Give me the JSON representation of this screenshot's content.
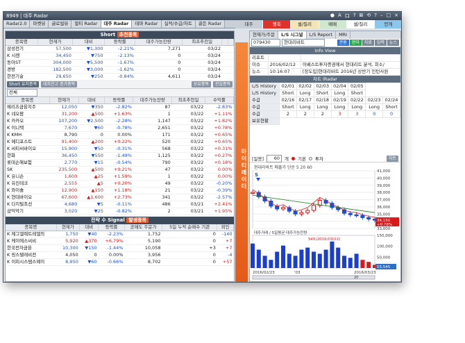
{
  "window": {
    "title": "8949 | 대주 Radar",
    "controls": [
      "●",
      "A",
      "口",
      "?",
      "⊠",
      "⟲",
      "?",
      "–",
      "□",
      "×"
    ]
  },
  "tabs": [
    "Radar2.0",
    "마켓뷰",
    "글로벌뷰",
    "멀티 Radar",
    "대주 Radar",
    "테마 Radar",
    "실적/수급/차트",
    "골든 Radar"
  ],
  "right_tabs": [
    {
      "label": "대주",
      "bg": "#c9cfd6"
    },
    {
      "label": "행복",
      "bg": "#e0312a",
      "color": "#fff"
    },
    {
      "label": "셀/질리",
      "bg": "#f4e4b8"
    },
    {
      "label": "매매",
      "bg": "#cfe8cf"
    },
    {
      "label": "셀/질리",
      "bg": "#ffffff"
    },
    {
      "label": "안개",
      "bg": "#8bc6ec"
    }
  ],
  "short_panel": {
    "title_prefix": "Short",
    "title_highlight": "추천종목",
    "headers": [
      "종목명",
      "현재가",
      "대비",
      "등락률",
      "대주가능잔량",
      "최초추천일",
      "",
      ""
    ],
    "rows": [
      {
        "name": "삼성전기",
        "price": "57,500",
        "arrow": "▼",
        "diff": "1,300",
        "rate": "-2.21%",
        "qty": "7,271",
        "date": "03/22",
        "c7": "",
        "c8": ""
      },
      {
        "name": "K 시젠",
        "price": "34,450",
        "arrow": "▼",
        "diff": "750",
        "rate": "-2.13%",
        "qty": "0",
        "date": "03/24",
        "c7": "",
        "c8": ""
      },
      {
        "name": "동아ST",
        "price": "304,000",
        "arrow": "▼",
        "diff": "5,500",
        "rate": "-1.67%",
        "qty": "0",
        "date": "03/24",
        "c7": "",
        "c8": ""
      },
      {
        "name": "경방",
        "price": "182,500",
        "arrow": "▼",
        "diff": "3,000",
        "rate": "-1.62%",
        "qty": "0",
        "date": "03/24",
        "c7": "",
        "c8": ""
      },
      {
        "name": "한전기술",
        "price": "29,650",
        "arrow": "▼",
        "diff": "250",
        "rate": "-0.84%",
        "qty": "4,611",
        "date": "03/24",
        "c7": "",
        "c8": ""
      }
    ]
  },
  "short_list": {
    "btn1": "Short 유지종목",
    "btn2": "대차잔고 증가종목",
    "btn3": "보유종목",
    "btn4": "관심종목",
    "select": "전체",
    "headers": [
      "종목명",
      "현재가",
      "대비",
      "등락률",
      "대주가능잔량",
      "최초추천일",
      "수익률"
    ],
    "rows": [
      {
        "name": "메리츠금융지주",
        "price": "12,050",
        "arrow": "▼",
        "diff": "350",
        "rate": "-2.82%",
        "qty": "87",
        "date": "03/22",
        "ret": "-2.83%",
        "dir": "dn"
      },
      {
        "name": "K 네오팜",
        "price": "31,200",
        "arrow": "▲",
        "diff": "500",
        "rate": "+1.63%",
        "qty": "1",
        "date": "03/22",
        "ret": "+1.11%",
        "dir": "up"
      },
      {
        "name": "K 카카오",
        "price": "107,200",
        "arrow": "▼",
        "diff": "2,500",
        "rate": "-2.28%",
        "qty": "1,147",
        "date": "03/22",
        "ret": "+1.82%",
        "dir": "dn"
      },
      {
        "name": "K 이니텍",
        "price": "7,670",
        "arrow": "▼",
        "diff": "60",
        "rate": "-0.78%",
        "qty": "2,651",
        "date": "03/22",
        "ret": "+0.78%",
        "dir": "dn"
      },
      {
        "name": "K KMH",
        "price": "8,790",
        "arrow": "",
        "diff": "0",
        "rate": "0.00%",
        "qty": "171",
        "date": "03/22",
        "ret": "+0.65%",
        "dir": ""
      },
      {
        "name": "K 메디포스트",
        "price": "91,400",
        "arrow": "▲",
        "diff": "200",
        "rate": "+0.22%",
        "qty": "520",
        "date": "03/22",
        "ret": "+0.65%",
        "dir": "up"
      },
      {
        "name": "K 씨티씨바이오",
        "price": "15,900",
        "arrow": "▼",
        "diff": "50",
        "rate": "-0.31%",
        "qty": "568",
        "date": "03/22",
        "ret": "+0.31%",
        "dir": "dn"
      },
      {
        "name": "한화",
        "price": "36,450",
        "arrow": "▼",
        "diff": "550",
        "rate": "-1.49%",
        "qty": "1,125",
        "date": "03/22",
        "ret": "+0.27%",
        "dir": "dn"
      },
      {
        "name": "롯데손해보험",
        "price": "2,770",
        "arrow": "▼",
        "diff": "15",
        "rate": "-0.54%",
        "qty": "790",
        "date": "03/22",
        "ret": "+0.18%",
        "dir": "dn"
      },
      {
        "name": "SK",
        "price": "235,500",
        "arrow": "▲",
        "diff": "500",
        "rate": "+0.21%",
        "qty": "47",
        "date": "03/22",
        "ret": "0.00%",
        "dir": "up"
      },
      {
        "name": "K 유니슨",
        "price": "1,600",
        "arrow": "▲",
        "diff": "25",
        "rate": "+1.59%",
        "qty": "1",
        "date": "03/22",
        "ret": "0.00%",
        "dir": "up"
      },
      {
        "name": "K 유진테크",
        "price": "2,555",
        "arrow": "▲",
        "diff": "5",
        "rate": "+0.20%",
        "qty": "49",
        "date": "03/22",
        "ret": "-0.20%",
        "dir": "up"
      },
      {
        "name": "K 와이솔",
        "price": "12,900",
        "arrow": "▲",
        "diff": "150",
        "rate": "+1.18%",
        "qty": "21",
        "date": "03/22",
        "ret": "-0.39%",
        "dir": "up"
      },
      {
        "name": "K 현대바이오",
        "price": "67,600",
        "arrow": "▲",
        "diff": "1,600",
        "rate": "+2.73%",
        "qty": "341",
        "date": "03/22",
        "ret": "-2.57%",
        "dir": "up"
      },
      {
        "name": "K 다지털조선",
        "price": "4,680",
        "arrow": "▼",
        "diff": "5",
        "rate": "-0.11%",
        "qty": "486",
        "date": "03/21",
        "ret": "+2.41%",
        "dir": "dn"
      },
      {
        "name": "삼익악기",
        "price": "3,020",
        "arrow": "▼",
        "diff": "25",
        "rate": "-0.82%",
        "qty": "2",
        "date": "03/21",
        "ret": "+1.95%",
        "dir": "dn"
      }
    ]
  },
  "signal_panel": {
    "title_prefix": "전략 수 Signal",
    "title_highlight": "발생종목",
    "headers": [
      "종목명",
      "현재가",
      "대비",
      "등락률",
      "공매도 주문가",
      "5일 누적 순매수 기관",
      "외인"
    ],
    "rows": [
      {
        "name": "K 제그엘렉트레엘의",
        "price": "1,750",
        "arrow": "▼",
        "diff": "40",
        "rate": "-2.23%",
        "qty": "1,752",
        "inst": "0",
        "frgn": "-140",
        "dir": "dn"
      },
      {
        "name": "K 케이에스씨비",
        "price": "5,920",
        "arrow": "▲",
        "diff": "370",
        "rate": "+6.79%",
        "qty": "5,190",
        "inst": "0",
        "frgn": "+7",
        "dir": "up"
      },
      {
        "name": "한국전자금융",
        "price": "10,300",
        "arrow": "▼",
        "diff": "150",
        "rate": "-1.44%",
        "qty": "10,058",
        "inst": "+3",
        "frgn": "+7",
        "dir": "dn"
      },
      {
        "name": "K 링스텔레비전",
        "price": "4,050",
        "arrow": "",
        "diff": "0",
        "rate": "0.00%",
        "qty": "3,956",
        "inst": "0",
        "frgn": "-4",
        "dir": ""
      },
      {
        "name": "K 이피시스템스웨이",
        "price": "8,950",
        "arrow": "▼",
        "diff": "60",
        "rate": "-0.66%",
        "qty": "8,702",
        "inst": "0",
        "frgn": "+57",
        "dir": "dn"
      }
    ]
  },
  "banner": "마이티레이더",
  "right": {
    "subtabs": [
      "현재가/주문",
      "L/S 시그널",
      "L/S Report",
      "MRI"
    ],
    "code": "079430",
    "code_name": "현대리바트",
    "btns": [
      {
        "l": "관원",
        "bg": "#2f74d0"
      },
      {
        "l": "현자",
        "bg": "#2aa84a"
      },
      {
        "l": "자료",
        "bg": "#7a8797"
      },
      {
        "l": "입력",
        "bg": "#7a8797"
      },
      {
        "l": "뉴스",
        "bg": "#7a8797"
      }
    ],
    "info_title": "Info View",
    "info_rows": [
      {
        "k": "리포트",
        "d": "",
        "v": ""
      },
      {
        "k": "이슈",
        "d": "2016/02/12",
        "v": "이베스트투자증권에서 현대리트 분석, 희소/"
      },
      {
        "k": "뉴스",
        "d": "10:16:07",
        "v": "[장도입]현대리바트 2016년 상반기 인턴사원"
      }
    ],
    "chart_title": "차트 lRadar",
    "history_label": "L/S History",
    "supply_label": "수급",
    "trade_label": "보유현황",
    "history_dates": [
      "02/01",
      "02/02",
      "02/03",
      "02/04",
      "02/05"
    ],
    "history_vals": [
      "Short",
      "Long",
      "Short",
      "Long",
      "Short"
    ],
    "supply_dates": [
      "02/16",
      "02/17",
      "02/18",
      "02/19",
      "02/22",
      "02/23",
      "02/24"
    ],
    "supply_row1": [
      "Short",
      "Long",
      "Long",
      "Long",
      "Long",
      "Long",
      "Short"
    ],
    "supply_row2": [
      "2",
      "2",
      "2",
      "3",
      "3",
      "0",
      "0"
    ],
    "chart_tools": {
      "period_label": "[일봉]",
      "period": "60",
      "unit": "개",
      "opt1": "기본",
      "opt2": "투자",
      "btn": "차트"
    },
    "chart_caption": "현대리바트 매출가 단순 5 20 60",
    "s_label": "S",
    "price_ticks": [
      "41,000",
      "40,000",
      "39,000",
      "38,000",
      "37,000",
      "36,000",
      "35,000",
      "34,000",
      "33,000"
    ],
    "vol_ticks": [
      "150,000",
      "100,000",
      "50,000",
      "10,300"
    ],
    "vol_caption": "대주거래 / 5일평균 대주가능잔량",
    "note": "545(2016/03/22)",
    "flag1": "34,150",
    "flag2": "+0.78%",
    "vol_flag": "15,545",
    "xlabels": [
      "2016/02/23",
      "'03",
      "2016/03/23"
    ],
    "scroll_label": "20"
  },
  "chart_data": {
    "type": "line",
    "title": "현대리바트",
    "x": [
      "02/23",
      "02/24",
      "02/25",
      "02/26",
      "02/29",
      "03/02",
      "03/03",
      "03/04",
      "03/07",
      "03/08",
      "03/09",
      "03/10",
      "03/11",
      "03/14",
      "03/15",
      "03/16",
      "03/17",
      "03/18",
      "03/21",
      "03/22",
      "03/23"
    ],
    "series": [
      {
        "name": "종가",
        "values": [
          38000,
          37400,
          36800,
          36100,
          35700,
          35900,
          35400,
          35000,
          35200,
          35500,
          36200,
          36900,
          36500,
          35900,
          35600,
          35100,
          34900,
          34800,
          34500,
          34300,
          34150
        ]
      }
    ],
    "volume": [
      120000,
      90000,
      60000,
      40000,
      80000,
      110000,
      70000,
      60000,
      90000,
      100000,
      80000,
      70000,
      90000,
      130000,
      100000,
      60000,
      50000,
      70000,
      40000,
      30000,
      15545
    ],
    "ylim": [
      33000,
      41000
    ]
  }
}
